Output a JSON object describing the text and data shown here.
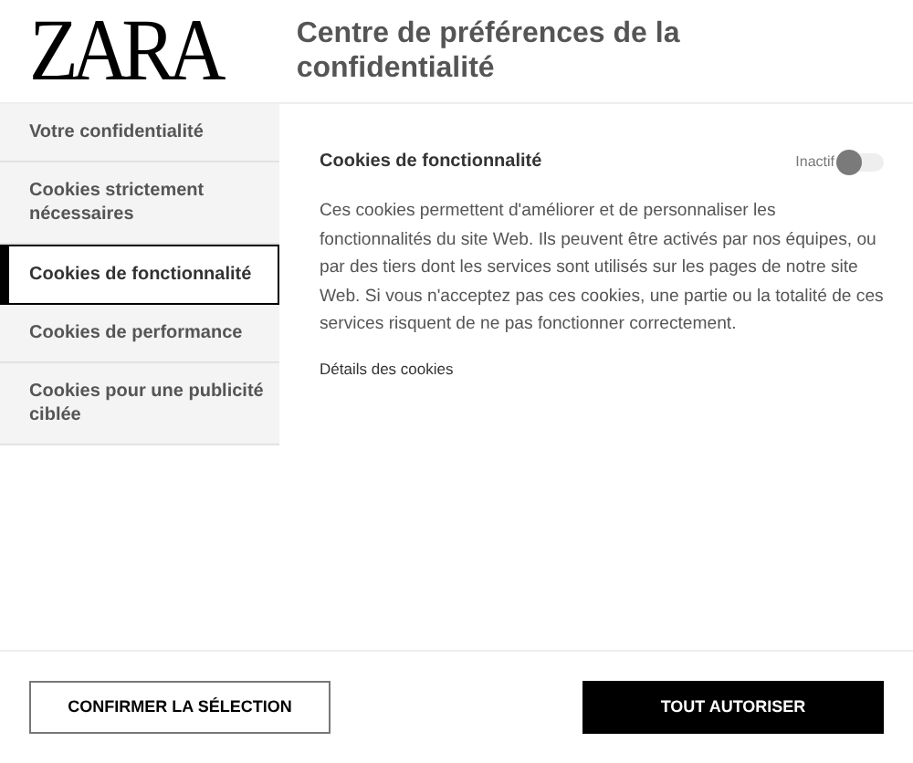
{
  "logo": "ZARA",
  "header": {
    "title": "Centre de préférences de la confidentialité"
  },
  "sidebar": {
    "items": [
      {
        "label": "Votre confidentialité",
        "selected": false
      },
      {
        "label": "Cookies strictement nécessaires",
        "selected": false
      },
      {
        "label": "Cookies de fonctionnalité",
        "selected": true
      },
      {
        "label": "Cookies de performance",
        "selected": false
      },
      {
        "label": "Cookies pour une publicité ciblée",
        "selected": false
      }
    ]
  },
  "panel": {
    "title": "Cookies de fonctionnalité",
    "toggle": {
      "label": "Inactif",
      "on": false
    },
    "description": "Ces cookies permettent d'améliorer et de personnaliser les fonctionnalités du site Web. Ils peuvent être activés par nos équipes, ou par des tiers dont les services sont utilisés sur les pages de notre site Web. Si vous n'acceptez pas ces cookies, une partie ou la totalité de ces services risquent de ne pas fonctionner correctement.",
    "link": "Détails des cookies"
  },
  "buttons": [
    {
      "label": "CONFIRMER LA SÉLECTION",
      "kind": "secondary"
    },
    {
      "label": "TOUT AUTORISER",
      "kind": "primary"
    }
  ]
}
